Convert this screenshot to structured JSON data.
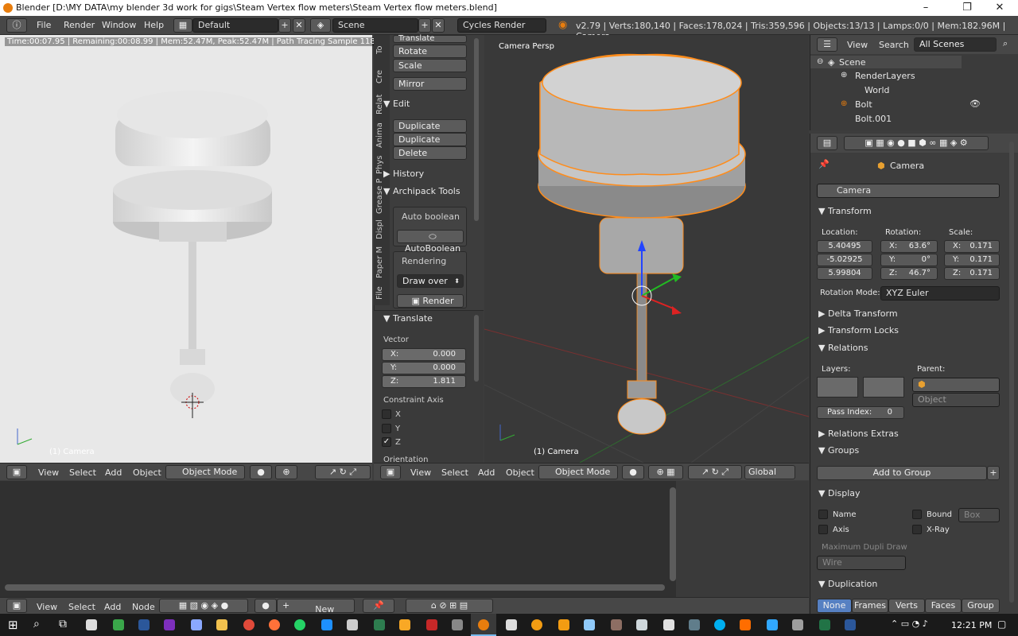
{
  "window": {
    "title": "Blender [D:\\MY DATA\\my blender 3d work for gigs\\Steam Vertex flow meters\\Steam Vertex flow meters.blend]"
  },
  "menubar": {
    "file": "File",
    "render": "Render",
    "window": "Window",
    "help": "Help",
    "layout": "Default",
    "scene": "Scene",
    "engine": "Cycles Render",
    "stats": "v2.79 | Verts:180,140 | Faces:178,024 | Tris:359,596 | Objects:13/13 | Lamps:0/0 | Mem:182.96M | Camera"
  },
  "render_view": {
    "info": "Time:00:07.95 | Remaining:00:08.99 | Mem:52.47M, Peak:52.47M | Path Tracing Sample 118/250",
    "label": "(1) Camera"
  },
  "tool_tabs": [
    "To",
    "Cre",
    "Relat",
    "Anima",
    "Phys",
    "Grease P",
    "Displ",
    "Paper M",
    "File"
  ],
  "tools": {
    "translate": "Translate",
    "rotate": "Rotate",
    "scale": "Scale",
    "mirror": "Mirror",
    "edit": "Edit",
    "duplicate": "Duplicate",
    "duplicate_linked": "Duplicate Linked",
    "delete": "Delete",
    "history": "History",
    "archipack": "Archipack Tools",
    "auto_boolean_label": "Auto boolean",
    "auto_boolean_btn": "AutoBoolean",
    "rendering_label": "Rendering",
    "draw_over": "Draw over",
    "render_btn": "Render"
  },
  "operator": {
    "title": "Translate",
    "vector": "Vector",
    "x_label": "X:",
    "x": "0.000",
    "y_label": "Y:",
    "y": "0.000",
    "z_label": "Z:",
    "z": "1.811",
    "constraint": "Constraint Axis",
    "cx": "X",
    "cy": "Y",
    "cz": "Z",
    "orientation": "Orientation"
  },
  "viewport": {
    "label": "Camera Persp",
    "bottom_label": "(1) Camera"
  },
  "view_header": {
    "view": "View",
    "select": "Select",
    "add": "Add",
    "object": "Object",
    "mode": "Object Mode",
    "orientation": "Global"
  },
  "node_header": {
    "view": "View",
    "select": "Select",
    "add": "Add",
    "node": "Node",
    "new": "New"
  },
  "outliner": {
    "view": "View",
    "search": "Search",
    "scenes": "All Scenes",
    "items": [
      "Scene",
      "RenderLayers",
      "World",
      "Bolt",
      "Bolt.001"
    ]
  },
  "properties": {
    "object_name": "Camera",
    "breadcrumb": "Camera",
    "transform": "Transform",
    "location": "Location:",
    "rotation": "Rotation:",
    "scale": "Scale:",
    "loc": [
      "5.40495",
      "-5.02925",
      "5.99804"
    ],
    "rot": [
      "63.6°",
      "0°",
      "46.7°"
    ],
    "scl": [
      "0.171",
      "0.171",
      "0.171"
    ],
    "rot_labels": [
      "X:",
      "Y:",
      "Z:"
    ],
    "scl_labels": [
      "X:",
      "Y:",
      "Z:"
    ],
    "rotation_mode_label": "Rotation Mode:",
    "rotation_mode": "XYZ Euler",
    "delta": "Delta Transform",
    "locks": "Transform Locks",
    "relations": "Relations",
    "layers": "Layers:",
    "parent": "Parent:",
    "parent_type": "Object",
    "pass_index_label": "Pass Index:",
    "pass_index": "0",
    "relations_extras": "Relations Extras",
    "groups": "Groups",
    "add_to_group": "Add to Group",
    "display": "Display",
    "name": "Name",
    "axis": "Axis",
    "bound": "Bound",
    "bound_type": "Box",
    "xray": "X-Ray",
    "max_dupli": "Maximum Dupli Draw",
    "wire": "Wire",
    "duplication": "Duplication",
    "dup_tabs": [
      "None",
      "Frames",
      "Verts",
      "Faces",
      "Group"
    ]
  },
  "taskbar": {
    "time": "12:21 PM"
  }
}
